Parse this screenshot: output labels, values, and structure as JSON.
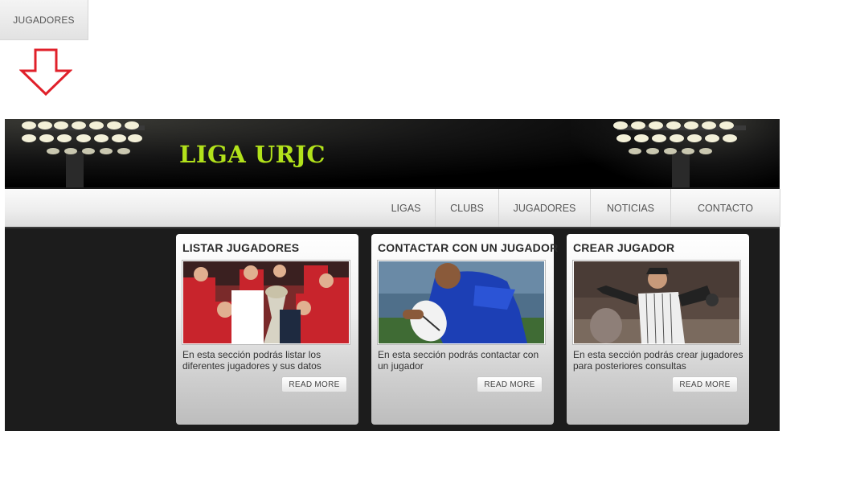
{
  "top_tab": {
    "label": "JUGADORES"
  },
  "banner": {
    "logo_text": "LIGA URJC"
  },
  "nav": {
    "items": [
      {
        "label": "LIGAS"
      },
      {
        "label": "CLUBS"
      },
      {
        "label": "JUGADORES"
      },
      {
        "label": "NOTICIAS"
      },
      {
        "label": "CONTACTO"
      }
    ]
  },
  "cards": [
    {
      "title": "LISTAR JUGADORES",
      "image": "football-celebration-trophy-photo",
      "text": "En esta sección podrás listar los diferentes jugadores y sus datos",
      "button": "READ MORE"
    },
    {
      "title": "CONTACTAR CON UN JUGADOR",
      "image": "rugby-player-photo",
      "text": "En esta sección podrás contactar con un jugador",
      "button": "READ MORE"
    },
    {
      "title": "CREAR JUGADOR",
      "image": "baseball-pitcher-photo",
      "text": "En esta sección podrás crear jugadores para posteriores consultas",
      "button": "READ MORE"
    }
  ],
  "colors": {
    "logo": "#b2e21b",
    "arrow": "#e0202a",
    "background_dark": "#1b1b1b"
  }
}
